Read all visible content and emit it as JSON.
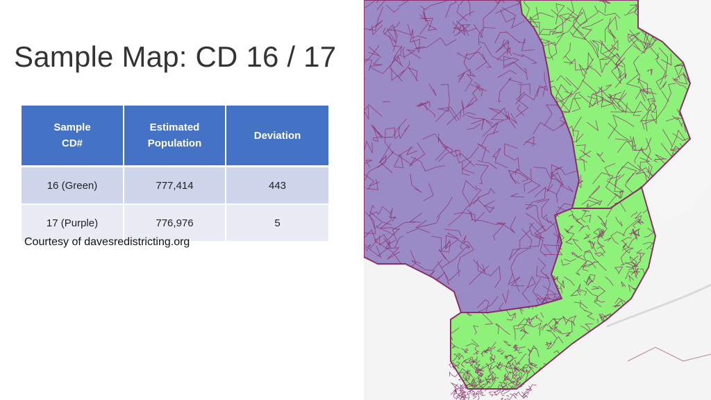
{
  "slide": {
    "title": "Sample Map: CD 16 / 17",
    "courtesy": "Courtesy of davesredistricting.org"
  },
  "table": {
    "headers": [
      {
        "line1": "Sample",
        "line2": "CD#"
      },
      {
        "line1": "Estimated",
        "line2": "Population"
      },
      {
        "line1": "Deviation",
        "line2": ""
      }
    ],
    "rows": [
      {
        "cd": "16 (Green)",
        "population": "777,414",
        "deviation": "443"
      },
      {
        "cd": "17 (Purple)",
        "population": "776,976",
        "deviation": "5"
      }
    ]
  },
  "map": {
    "colors": {
      "green_district": "#8ef27a",
      "purple_district": "#9a8ac6",
      "boundary": "#8b2f6b",
      "background": "#f2f2f2",
      "water": "#e6e6e6"
    }
  }
}
